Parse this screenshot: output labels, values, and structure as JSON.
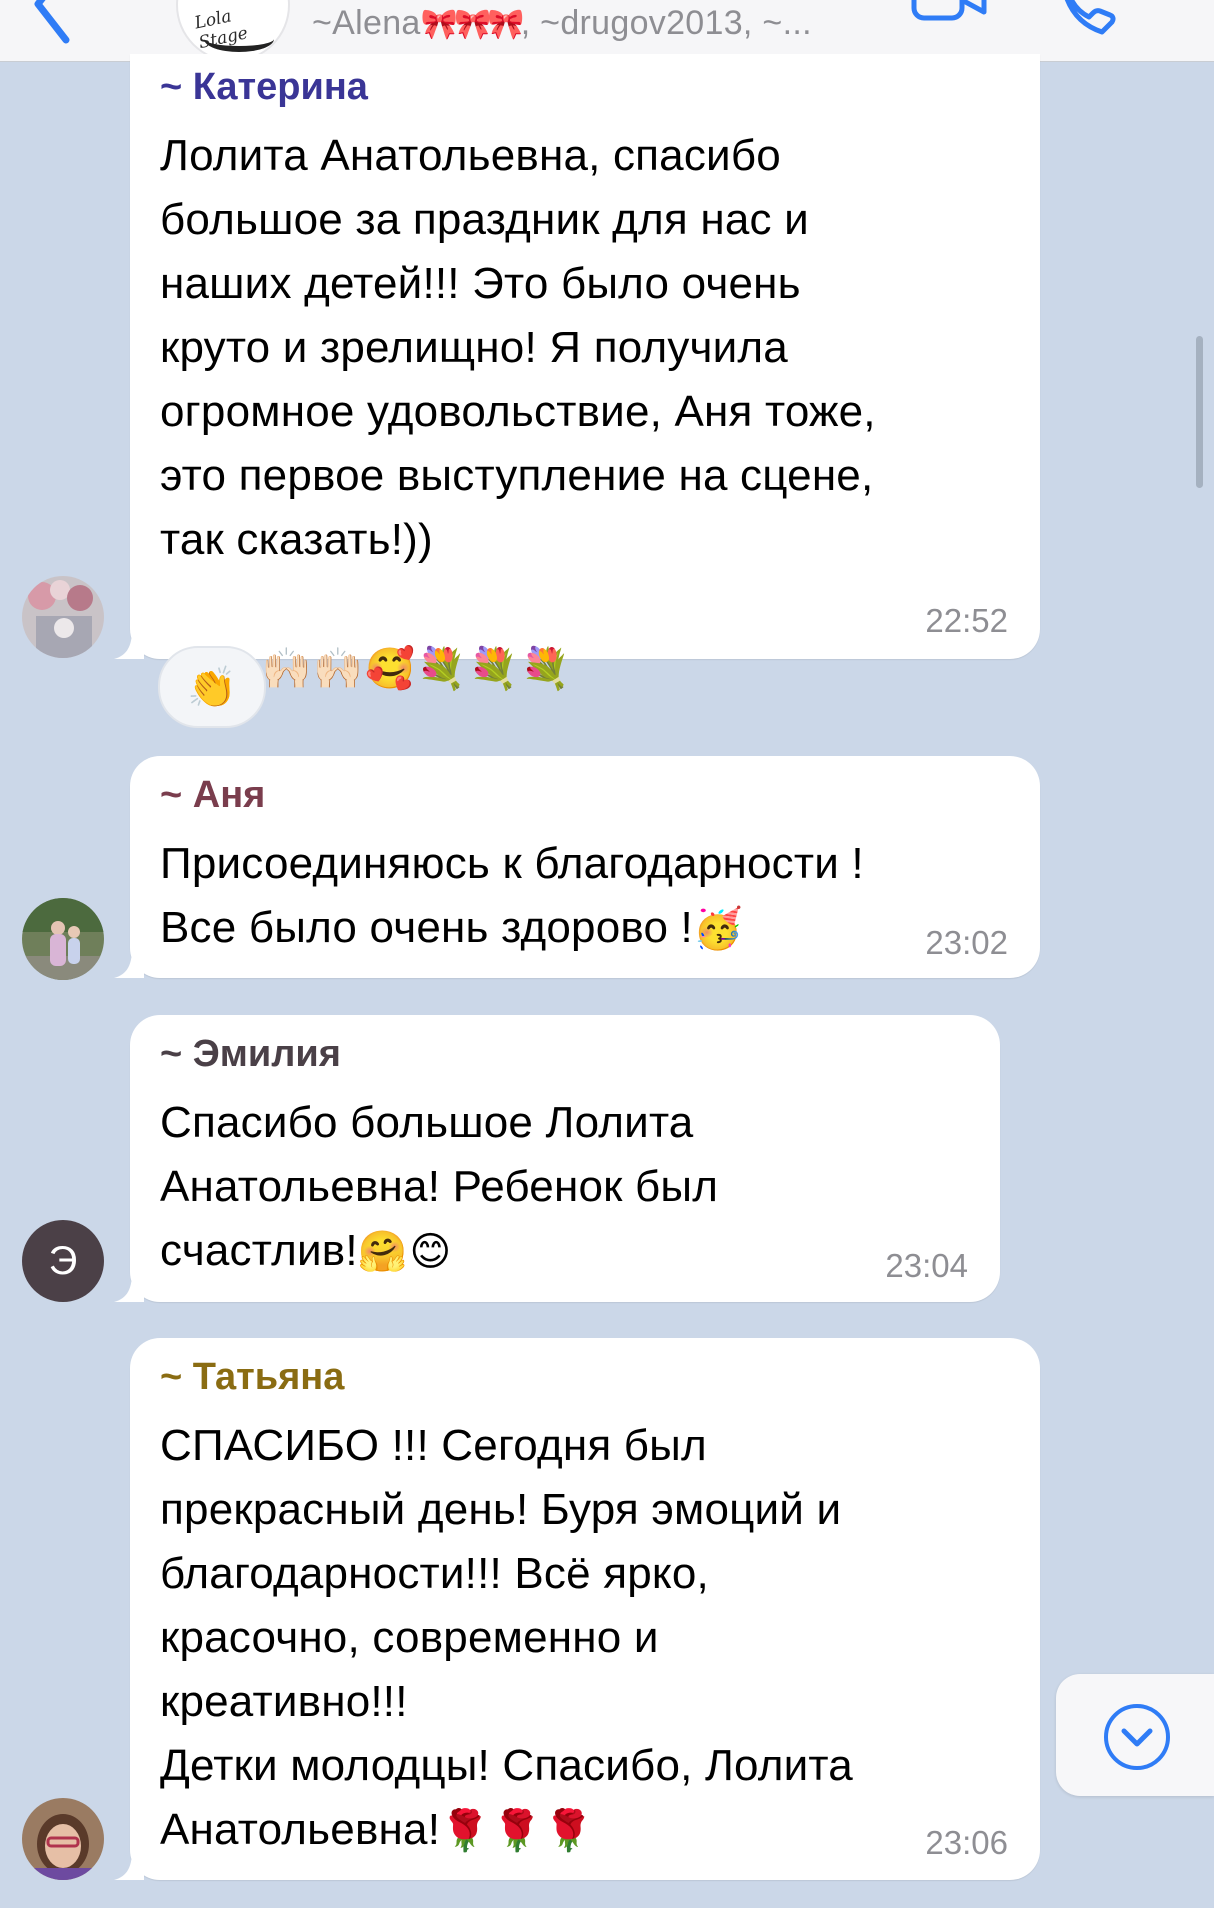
{
  "header": {
    "subtitle": "~Alena",
    "subtitle_bows": "🎀🎀🎀",
    "subtitle_rest": ", ~drugov2013, ~...",
    "logo_text": "Lola Stage",
    "accent_color": "#3b82f6",
    "icons": [
      "chevron-left-icon",
      "video-camera-icon",
      "phone-icon"
    ]
  },
  "messages": [
    {
      "sender": "~ Катерина",
      "sender_color": "#3a3596",
      "text": "Лолита Анатольевна, спасибо\nбольшое за праздник для нас и\nнаших детей!!! Это было очень\nкруто и зрелищно! Я получила\nогромное удовольствие, Аня тоже,\nэто первое выступление на сцене,\nтак сказать!))",
      "emoji_line": "🙌🏻🙌🏻🙌🏻🥰💐💐💐",
      "time": "22:52",
      "reaction": "👏"
    },
    {
      "sender": "~ Аня",
      "sender_color": "#7a3d4d",
      "text": "Присоединяюсь к благодарности !\nВсе было очень здорово !",
      "text_emoji": "🥳",
      "time": "23:02"
    },
    {
      "sender": "~ Эмилия",
      "sender_color": "#4a4047",
      "text": "Спасибо большое Лолита\nАнатольевна! Ребенок был\nсчастлив!",
      "text_emoji": "🤗😊",
      "time": "23:04",
      "avatar_letter": "Э"
    },
    {
      "sender": "~ Татьяна",
      "sender_color": "#8a6c12",
      "text": "СПАСИБО !!! Сегодня был\nпрекрасный день! Буря эмоций и\nблагодарности!!! Всё ярко,\nкрасочно, современно и\nкреативно!!!\nДетки молодцы! Спасибо, Лолита\nАнатольевна!",
      "text_emoji": "🌹🌹🌹",
      "time": "23:06"
    }
  ]
}
